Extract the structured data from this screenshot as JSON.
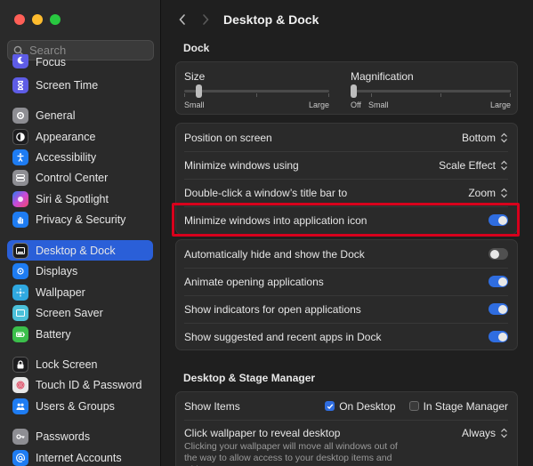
{
  "sidebar": {
    "search_placeholder": "Search",
    "items": [
      {
        "label": "Focus",
        "color": "#5e5ce6"
      },
      {
        "label": "Screen Time",
        "color": "#5e5ce6"
      },
      {
        "label": "General",
        "color": "#8e8e93"
      },
      {
        "label": "Appearance",
        "color": "#1c1c1e"
      },
      {
        "label": "Accessibility",
        "color": "#1e7cf2"
      },
      {
        "label": "Control Center",
        "color": "#8e8e93"
      },
      {
        "label": "Siri & Spotlight",
        "color": "#c94bd8"
      },
      {
        "label": "Privacy & Security",
        "color": "#1e7cf2"
      },
      {
        "label": "Desktop & Dock",
        "color": "#1c1c1e"
      },
      {
        "label": "Displays",
        "color": "#1e7cf2"
      },
      {
        "label": "Wallpaper",
        "color": "#2fa8e0"
      },
      {
        "label": "Screen Saver",
        "color": "#4bc0d9"
      },
      {
        "label": "Battery",
        "color": "#3bbf4b"
      },
      {
        "label": "Lock Screen",
        "color": "#1c1c1e"
      },
      {
        "label": "Touch ID & Password",
        "color": "#e8e8e8"
      },
      {
        "label": "Users & Groups",
        "color": "#1e7cf2"
      },
      {
        "label": "Passwords",
        "color": "#8e8e93"
      },
      {
        "label": "Internet Accounts",
        "color": "#1e7cf2"
      }
    ]
  },
  "header": {
    "title": "Desktop & Dock"
  },
  "dock": {
    "section_title": "Dock",
    "size": {
      "label": "Size",
      "min_label": "Small",
      "max_label": "Large",
      "value": 0.1
    },
    "magnification": {
      "label": "Magnification",
      "off_label": "Off",
      "min_label": "Small",
      "max_label": "Large",
      "value": 0.0
    },
    "rows": [
      {
        "label": "Position on screen",
        "value": "Bottom"
      },
      {
        "label": "Minimize windows using",
        "value": "Scale Effect"
      },
      {
        "label": "Double-click a window’s title bar to",
        "value": "Zoom"
      }
    ],
    "minimize_into_icon": {
      "label": "Minimize windows into application icon",
      "on": true
    },
    "toggles": [
      {
        "label": "Automatically hide and show the Dock",
        "on": false
      },
      {
        "label": "Animate opening applications",
        "on": true
      },
      {
        "label": "Show indicators for open applications",
        "on": true
      },
      {
        "label": "Show suggested and recent apps in Dock",
        "on": true
      }
    ]
  },
  "desktop": {
    "section_title": "Desktop & Stage Manager",
    "show_items": {
      "label": "Show Items",
      "on_desktop": "On Desktop",
      "in_stage_manager": "In Stage Manager"
    },
    "click_wallpaper": {
      "label": "Click wallpaper to reveal desktop",
      "value": "Always",
      "description": "Clicking your wallpaper will move all windows out of the way to allow access to your desktop items and widgets."
    }
  },
  "colors": {
    "accent": "#2f6de0",
    "highlight": "#d8001c"
  }
}
